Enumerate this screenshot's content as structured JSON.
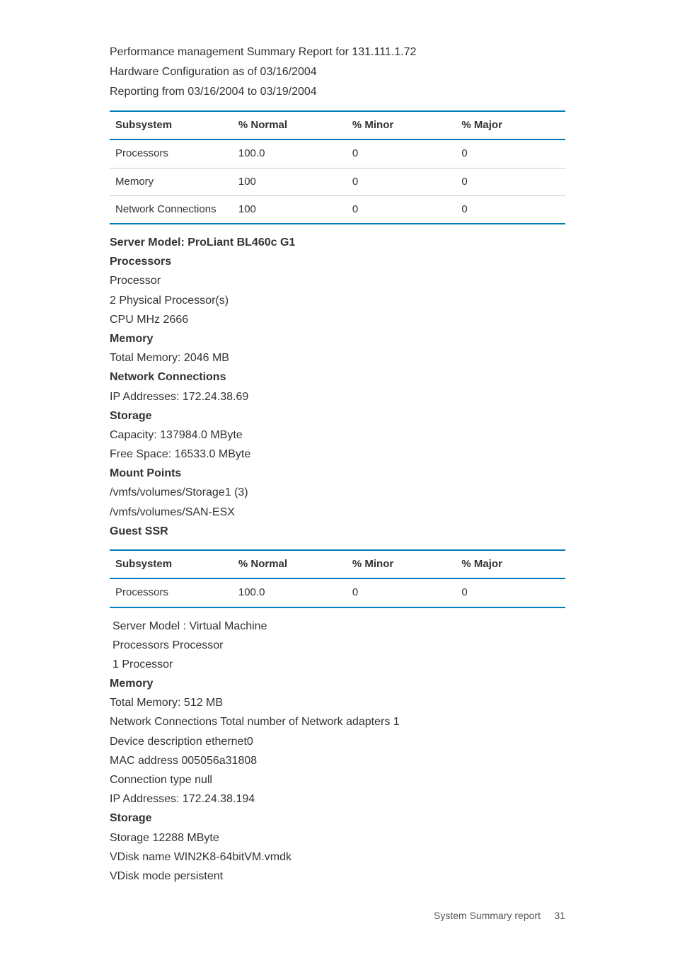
{
  "header": {
    "line1": "Performance management Summary Report for 131.111.1.72",
    "line2": "Hardware Configuration as of 03/16/2004",
    "line3": "Reporting from 03/16/2004 to 03/19/2004"
  },
  "table1": {
    "headers": {
      "c0": "Subsystem",
      "c1": "% Normal",
      "c2": "% Minor",
      "c3": "% Major"
    },
    "rows": [
      {
        "c0": "Processors",
        "c1": "100.0",
        "c2": "0",
        "c3": "0"
      },
      {
        "c0": "Memory",
        "c1": "100",
        "c2": "0",
        "c3": "0"
      },
      {
        "c0": "Network Connections",
        "c1": "100",
        "c2": "0",
        "c3": "0"
      }
    ]
  },
  "server1": {
    "model": "Server Model: ProLiant BL460c G1",
    "processors_heading": "Processors",
    "processor_line1": "Processor",
    "processor_line2": "2 Physical Processor(s)",
    "processor_line3": "CPU MHz 2666",
    "memory_heading": "Memory",
    "memory_line1": "Total Memory: 2046 MB",
    "network_heading": "Network Connections",
    "network_line1": "IP Addresses: 172.24.38.69",
    "storage_heading": "Storage",
    "storage_line1": "Capacity: 137984.0 MByte",
    "storage_line2": "Free Space: 16533.0 MByte",
    "mount_heading": "Mount Points",
    "mount_line1": "/vmfs/volumes/Storage1 (3)",
    "mount_line2": "/vmfs/volumes/SAN-ESX",
    "guest_heading": "Guest SSR"
  },
  "table2": {
    "headers": {
      "c0": "Subsystem",
      "c1": "% Normal",
      "c2": "% Minor",
      "c3": "% Major"
    },
    "rows": [
      {
        "c0": "Processors",
        "c1": "100.0",
        "c2": "0",
        "c3": "0"
      }
    ]
  },
  "server2": {
    "model": "Server Model : Virtual Machine",
    "proc_line1": "Processors Processor",
    "proc_line2": "1 Processor",
    "memory_heading": "Memory",
    "mem_line1": "Total Memory: 512 MB",
    "mem_line2": "Network Connections Total number of Network adapters 1",
    "mem_line3": "Device description ethernet0",
    "mem_line4": "MAC address 005056a31808",
    "mem_line5": "Connection type null",
    "mem_line6": "IP Addresses: 172.24.38.194",
    "storage_heading": "Storage",
    "storage_line1": "Storage 12288 MByte",
    "storage_line2": "VDisk name WIN2K8-64bitVM.vmdk",
    "storage_line3": "VDisk mode persistent"
  },
  "footer": {
    "text": "System Summary report",
    "page": "31"
  }
}
